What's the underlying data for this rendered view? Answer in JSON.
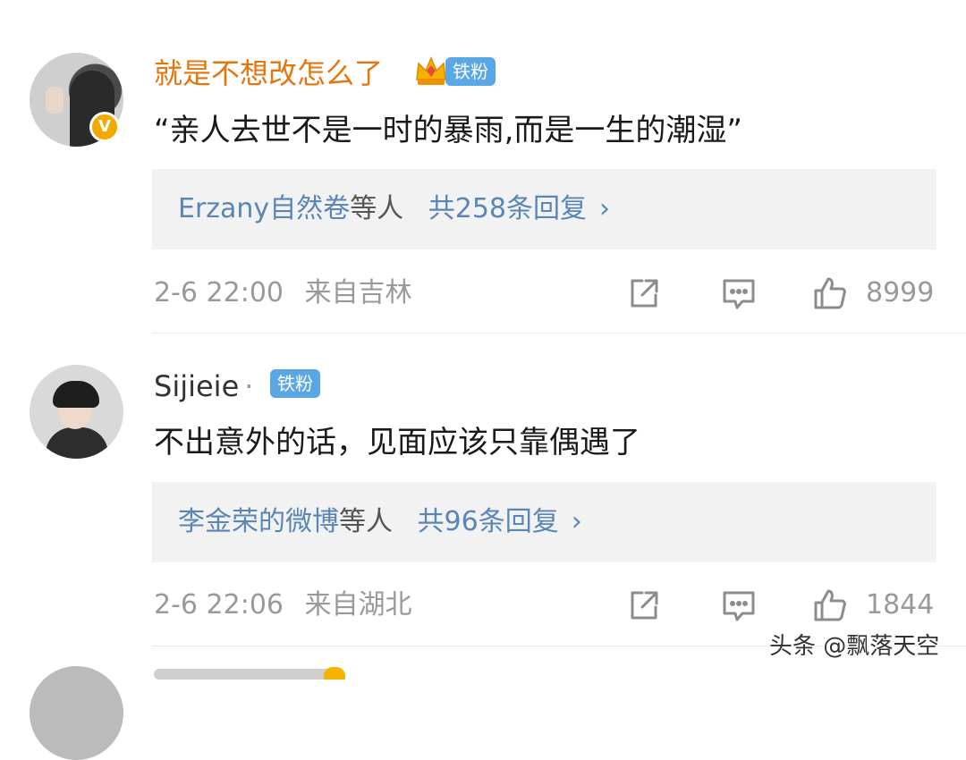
{
  "comments": [
    {
      "username": "就是不想改怎么了",
      "fan_badge": "铁粉",
      "verified_mark": "V",
      "text": "“亲人去世不是一时的暴雨,而是一生的潮湿”",
      "reply_names": "Erzany自然卷",
      "reply_connector": "等人",
      "reply_count": "共258条回复",
      "reply_chevron": "›",
      "date": "2-6 22:00",
      "location": "来自吉林",
      "likes": "8999"
    },
    {
      "username": "Sijieie",
      "name_separator": "·",
      "fan_badge": "铁粉",
      "text": "不出意外的话，见面应该只靠偶遇了",
      "reply_names": "李金荣的微博",
      "reply_connector": "等人",
      "reply_count": "共96条回复",
      "reply_chevron": "›",
      "date": "2-6 22:06",
      "location": "来自湖北",
      "likes": "1844"
    }
  ],
  "watermark": "头条 @飘落天空",
  "colors": {
    "username_vip": "#e8740c",
    "fan_badge": "#5aa7e6",
    "reply_link": "#5a86b5",
    "reply_bg": "#f2f2f2",
    "meta": "#999999"
  },
  "icons": [
    "crown-icon",
    "verified-icon",
    "share-icon",
    "comment-icon",
    "like-icon",
    "chevron-right-icon"
  ]
}
